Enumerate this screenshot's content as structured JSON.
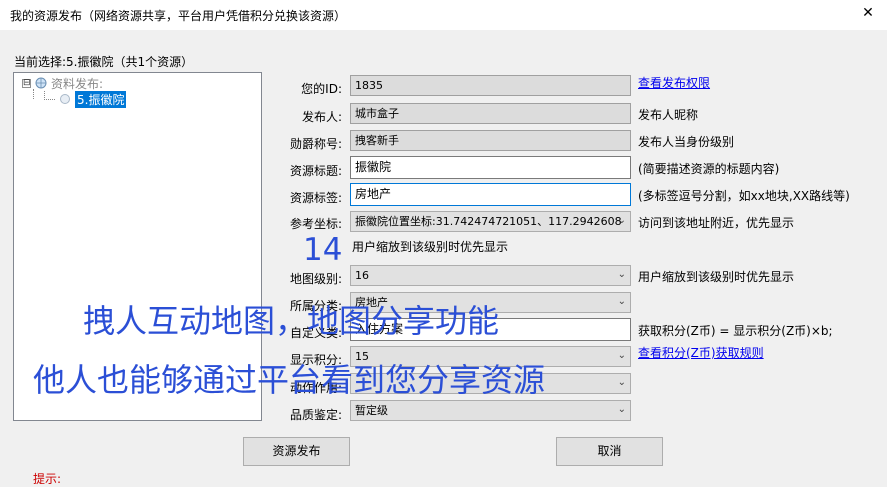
{
  "window": {
    "title": "我的资源发布（网络资源共享，平台用户凭借积分兑换该资源）",
    "close_glyph": "✕"
  },
  "current_selection": "当前选择:5.振徽院（共1个资源）",
  "tree": {
    "root_label": "资料发布:",
    "expander_glyph": "⊟",
    "child_label": "5.振徽院"
  },
  "fields": {
    "id": {
      "label": "您的ID:",
      "value": "1835",
      "hint": "查看发布权限"
    },
    "publisher": {
      "label": "发布人:",
      "value": "城市盒子",
      "hint": "发布人昵称"
    },
    "medal": {
      "label": "勋爵称号:",
      "value": "拽客新手",
      "hint": "发布人当身份级别"
    },
    "res_title": {
      "label": "资源标题:",
      "value": "振徽院",
      "hint": "(简要描述资源的标题内容)"
    },
    "res_tags": {
      "label": "资源标签:",
      "value": "房地产",
      "hint": "(多标签逗号分割，如xx地块,XX路线等)"
    },
    "ref_coord": {
      "label": "参考坐标:",
      "value": "振徽院位置坐标:31.742474721051、117.2942608",
      "hint": "访问到该地址附近，优先显示"
    },
    "zoom_note": "用户缩放到该级别时优先显示",
    "map_level": {
      "label": "地图级别:",
      "value": "16",
      "hint": "用户缩放到该级别时优先显示"
    },
    "category": {
      "label": "所属分类:",
      "value": "房地产"
    },
    "custom_type": {
      "label": "自定义类:",
      "value": "入住方案",
      "hint": "获取积分(Z币) = 显示积分(Z币)×b;"
    },
    "display_points": {
      "label": "显示积分:",
      "value": "15",
      "hint": "查看积分(Z币)获取规则"
    },
    "action": {
      "label": "动作作用:",
      "value": ""
    },
    "quality": {
      "label": "品质鉴定:",
      "value": "暂定级"
    }
  },
  "overlay": {
    "level_number": "14",
    "line1": "拽人互动地图，地图分享功能",
    "line2": "他人也能够通过平台看到您分享资源"
  },
  "buttons": {
    "publish": "资源发布",
    "cancel": "取消"
  },
  "tips_label": "提示:",
  "colors": {
    "selection": "#0078d7",
    "overlay_text": "#2b4fd6",
    "link": "#0000ee",
    "tips": "#cc0000"
  }
}
